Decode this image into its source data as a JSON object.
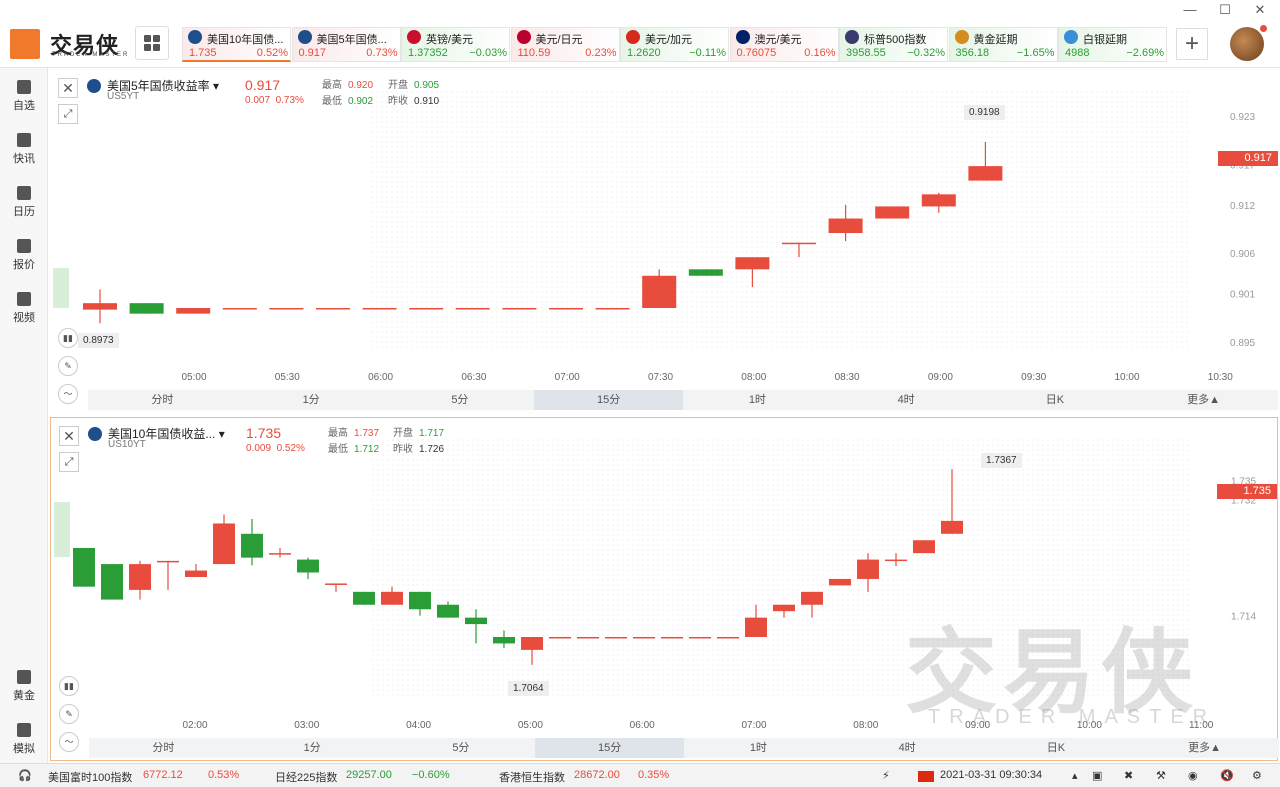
{
  "app": {
    "logo_text": "交易侠",
    "logo_sub": "TRADER MASTER"
  },
  "window_controls": {
    "minimize": "—",
    "maximize": "☐",
    "close": "✕"
  },
  "tickers": [
    {
      "name": "美国10年国债...",
      "price": "1.735",
      "change": "0.52%",
      "dir": "up"
    },
    {
      "name": "美国5年国债...",
      "price": "0.917",
      "change": "0.73%",
      "dir": "up"
    },
    {
      "name": "英镑/美元",
      "price": "1.37352",
      "change": "−0.03%",
      "dir": "down"
    },
    {
      "name": "美元/日元",
      "price": "110.59",
      "change": "0.23%",
      "dir": "up"
    },
    {
      "name": "美元/加元",
      "price": "1.2620",
      "change": "−0.11%",
      "dir": "down"
    },
    {
      "name": "澳元/美元",
      "price": "0.76075",
      "change": "0.16%",
      "dir": "up"
    },
    {
      "name": "标普500指数",
      "price": "3958.55",
      "change": "−0.32%",
      "dir": "down"
    },
    {
      "name": "黄金延期",
      "price": "356.18",
      "change": "−1.65%",
      "dir": "down"
    },
    {
      "name": "白银延期",
      "price": "4988",
      "change": "−2.69%",
      "dir": "down"
    }
  ],
  "sidebar": {
    "items": [
      {
        "label": "自选",
        "icon": "bookmark-icon"
      },
      {
        "label": "快讯",
        "icon": "news-icon"
      },
      {
        "label": "日历",
        "icon": "calendar-icon"
      },
      {
        "label": "报价",
        "icon": "quote-icon"
      },
      {
        "label": "视频",
        "icon": "video-icon"
      },
      {
        "label": "黄金",
        "icon": "gold-icon"
      },
      {
        "label": "模拟",
        "icon": "wallet-icon"
      }
    ]
  },
  "timeframes": [
    "分时",
    "1分",
    "5分",
    "15分",
    "1时",
    "4时",
    "日K",
    "更多▲"
  ],
  "panels": [
    {
      "title": "美国5年国债收益率",
      "code": "US5YT",
      "price": "0.917",
      "change": "0.007",
      "change_pct": "0.73%",
      "high": "0.920",
      "open": "0.905",
      "low": "0.902",
      "prev_close": "0.910",
      "labels": {
        "high": "最高",
        "open": "开盘",
        "low": "最低",
        "prev": "昨收"
      },
      "price_tag": "0.917",
      "max_tag": "0.9198",
      "min_tag": "0.8973"
    },
    {
      "title": "美国10年国债收益...",
      "code": "US10YT",
      "price": "1.735",
      "change": "0.009",
      "change_pct": "0.52%",
      "high": "1.737",
      "open": "1.717",
      "low": "1.712",
      "prev_close": "1.726",
      "labels": {
        "high": "最高",
        "open": "开盘",
        "low": "最低",
        "prev": "昨收"
      },
      "price_tag": "1.735",
      "max_tag": "1.7367",
      "min_tag": "1.7064"
    }
  ],
  "chart_data": [
    {
      "type": "candlestick",
      "title": "美国5年国债收益率",
      "y_ticks": [
        "0.923",
        "0.917",
        "0.912",
        "0.906",
        "0.901",
        "0.895"
      ],
      "x_ticks": [
        "05:00",
        "05:30",
        "06:00",
        "06:30",
        "07:00",
        "07:30",
        "08:00",
        "08:30",
        "09:00",
        "09:30",
        "10:00",
        "10:30"
      ],
      "ylim": [
        0.893,
        0.925
      ],
      "candles": [
        {
          "o": 0.899,
          "h": 0.9015,
          "l": 0.8973,
          "c": 0.8998
        },
        {
          "o": 0.8998,
          "h": 0.8998,
          "l": 0.8985,
          "c": 0.8985
        },
        {
          "o": 0.8985,
          "h": 0.8992,
          "l": 0.8985,
          "c": 0.8992
        },
        {
          "o": 0.8992,
          "h": 0.8992,
          "l": 0.8992,
          "c": 0.8992
        },
        {
          "o": 0.8992,
          "h": 0.8992,
          "l": 0.8992,
          "c": 0.8992
        },
        {
          "o": 0.8992,
          "h": 0.8992,
          "l": 0.8992,
          "c": 0.8992
        },
        {
          "o": 0.8992,
          "h": 0.8992,
          "l": 0.8992,
          "c": 0.8992
        },
        {
          "o": 0.8992,
          "h": 0.8992,
          "l": 0.8992,
          "c": 0.8992
        },
        {
          "o": 0.8992,
          "h": 0.8992,
          "l": 0.8992,
          "c": 0.8992
        },
        {
          "o": 0.8992,
          "h": 0.8992,
          "l": 0.8992,
          "c": 0.8992
        },
        {
          "o": 0.8992,
          "h": 0.8992,
          "l": 0.8992,
          "c": 0.8992
        },
        {
          "o": 0.8992,
          "h": 0.8992,
          "l": 0.8992,
          "c": 0.8992
        },
        {
          "o": 0.8992,
          "h": 0.904,
          "l": 0.8992,
          "c": 0.9032
        },
        {
          "o": 0.904,
          "h": 0.904,
          "l": 0.9032,
          "c": 0.9032
        },
        {
          "o": 0.904,
          "h": 0.9055,
          "l": 0.9018,
          "c": 0.9055
        },
        {
          "o": 0.9073,
          "h": 0.9073,
          "l": 0.9055,
          "c": 0.9073
        },
        {
          "o": 0.9085,
          "h": 0.912,
          "l": 0.9075,
          "c": 0.9103
        },
        {
          "o": 0.9103,
          "h": 0.9118,
          "l": 0.9103,
          "c": 0.9118
        },
        {
          "o": 0.9118,
          "h": 0.9135,
          "l": 0.911,
          "c": 0.9133
        },
        {
          "o": 0.915,
          "h": 0.9198,
          "l": 0.915,
          "c": 0.9168
        }
      ]
    },
    {
      "type": "candlestick",
      "title": "美国10年国债收益...",
      "y_ticks": [
        "1.735",
        "1.732",
        "1.714"
      ],
      "x_ticks": [
        "02:00",
        "03:00",
        "04:00",
        "05:00",
        "06:00",
        "07:00",
        "08:00",
        "09:00",
        "10:00",
        "11:00"
      ],
      "ylim": [
        1.7,
        1.74
      ],
      "candles": [
        {
          "o": 1.7245,
          "h": 1.7245,
          "l": 1.7185,
          "c": 1.7185
        },
        {
          "o": 1.722,
          "h": 1.722,
          "l": 1.7165,
          "c": 1.7165
        },
        {
          "o": 1.718,
          "h": 1.7225,
          "l": 1.7165,
          "c": 1.722
        },
        {
          "o": 1.7225,
          "h": 1.7225,
          "l": 1.718,
          "c": 1.7225
        },
        {
          "o": 1.72,
          "h": 1.722,
          "l": 1.72,
          "c": 1.721
        },
        {
          "o": 1.722,
          "h": 1.7297,
          "l": 1.722,
          "c": 1.7283
        },
        {
          "o": 1.7267,
          "h": 1.729,
          "l": 1.7218,
          "c": 1.723
        },
        {
          "o": 1.7237,
          "h": 1.7245,
          "l": 1.723,
          "c": 1.7237
        },
        {
          "o": 1.7227,
          "h": 1.723,
          "l": 1.7197,
          "c": 1.7207
        },
        {
          "o": 1.719,
          "h": 1.719,
          "l": 1.7177,
          "c": 1.719
        },
        {
          "o": 1.7177,
          "h": 1.7177,
          "l": 1.7157,
          "c": 1.7157
        },
        {
          "o": 1.7157,
          "h": 1.7185,
          "l": 1.7157,
          "c": 1.7177
        },
        {
          "o": 1.7177,
          "h": 1.7177,
          "l": 1.714,
          "c": 1.715
        },
        {
          "o": 1.7157,
          "h": 1.7162,
          "l": 1.7137,
          "c": 1.7137
        },
        {
          "o": 1.7137,
          "h": 1.715,
          "l": 1.7097,
          "c": 1.7127
        },
        {
          "o": 1.7107,
          "h": 1.7117,
          "l": 1.709,
          "c": 1.7097
        },
        {
          "o": 1.7087,
          "h": 1.7107,
          "l": 1.7064,
          "c": 1.7107
        },
        {
          "o": 1.7107,
          "h": 1.7107,
          "l": 1.7107,
          "c": 1.7107
        },
        {
          "o": 1.7107,
          "h": 1.7107,
          "l": 1.7107,
          "c": 1.7107
        },
        {
          "o": 1.7107,
          "h": 1.7107,
          "l": 1.7107,
          "c": 1.7107
        },
        {
          "o": 1.7107,
          "h": 1.7107,
          "l": 1.7107,
          "c": 1.7107
        },
        {
          "o": 1.7107,
          "h": 1.7107,
          "l": 1.7107,
          "c": 1.7107
        },
        {
          "o": 1.7107,
          "h": 1.7107,
          "l": 1.7107,
          "c": 1.7107
        },
        {
          "o": 1.7107,
          "h": 1.7107,
          "l": 1.7107,
          "c": 1.7107
        },
        {
          "o": 1.7107,
          "h": 1.7157,
          "l": 1.7107,
          "c": 1.7137
        },
        {
          "o": 1.7147,
          "h": 1.7157,
          "l": 1.7137,
          "c": 1.7157
        },
        {
          "o": 1.7157,
          "h": 1.7177,
          "l": 1.7137,
          "c": 1.7177
        },
        {
          "o": 1.7187,
          "h": 1.7197,
          "l": 1.7187,
          "c": 1.7197
        },
        {
          "o": 1.7197,
          "h": 1.7237,
          "l": 1.7177,
          "c": 1.7227
        },
        {
          "o": 1.7227,
          "h": 1.7237,
          "l": 1.7217,
          "c": 1.7227
        },
        {
          "o": 1.7237,
          "h": 1.7257,
          "l": 1.7237,
          "c": 1.7257
        },
        {
          "o": 1.7267,
          "h": 1.7367,
          "l": 1.7267,
          "c": 1.7287
        }
      ]
    }
  ],
  "statusbar": {
    "items": [
      {
        "name": "美国富时100指数",
        "value": "6772.12",
        "change": "0.53%",
        "dir": "up"
      },
      {
        "name": "日经225指数",
        "value": "29257.00",
        "change": "−0.60%",
        "dir": "down"
      },
      {
        "name": "香港恒生指数",
        "value": "28672.00",
        "change": "0.35%",
        "dir": "up"
      }
    ],
    "datetime": "2021-03-31  09:30:34"
  },
  "watermark": {
    "main": "交易侠",
    "sub": "TRADER MASTER"
  },
  "colors": {
    "up": "#e84c3d",
    "down": "#2a9d36",
    "accent": "#f0792b"
  }
}
